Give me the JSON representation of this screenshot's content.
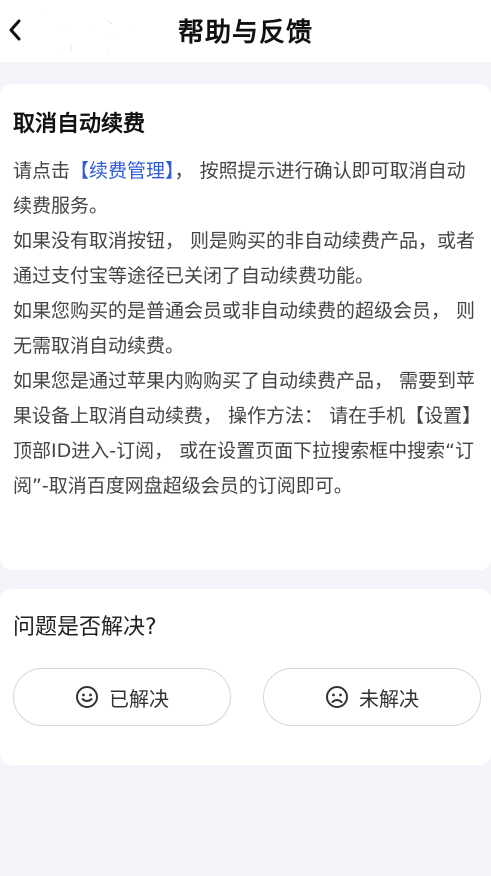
{
  "header": {
    "title": "帮助与反馈",
    "watermark_line1": "游吧乐下载",
    "watermark_line2": "小编亲测"
  },
  "article": {
    "title": "取消自动续费",
    "p1_before": "请点击",
    "p1_link": "【续费管理】",
    "p1_after": "， 按照提示进行确认即可取消自动续费服务。",
    "p2": "如果没有取消按钮， 则是购买的非自动续费产品，或者通过支付宝等途径已关闭了自动续费功能。",
    "p3": "如果您购买的是普通会员或非自动续费的超级会员， 则无需取消自动续费。",
    "p4": "如果您是通过苹果内购购买了自动续费产品， 需要到苹果设备上取消自动续费， 操作方法： 请在手机【设置】顶部ID进入-订阅， 或在设置页面下拉搜索框中搜索“订阅”-取消百度网盘超级会员的订阅即可。"
  },
  "feedback": {
    "question": "问题是否解决?",
    "yes_label": "已解决",
    "no_label": "未解决"
  },
  "colors": {
    "link": "#2f5bd8",
    "background": "#f3f5fb",
    "watermark": "#19d3e0"
  },
  "icons": {
    "back": "chevron-left-icon",
    "yes": "smile-icon",
    "no": "frown-icon"
  }
}
